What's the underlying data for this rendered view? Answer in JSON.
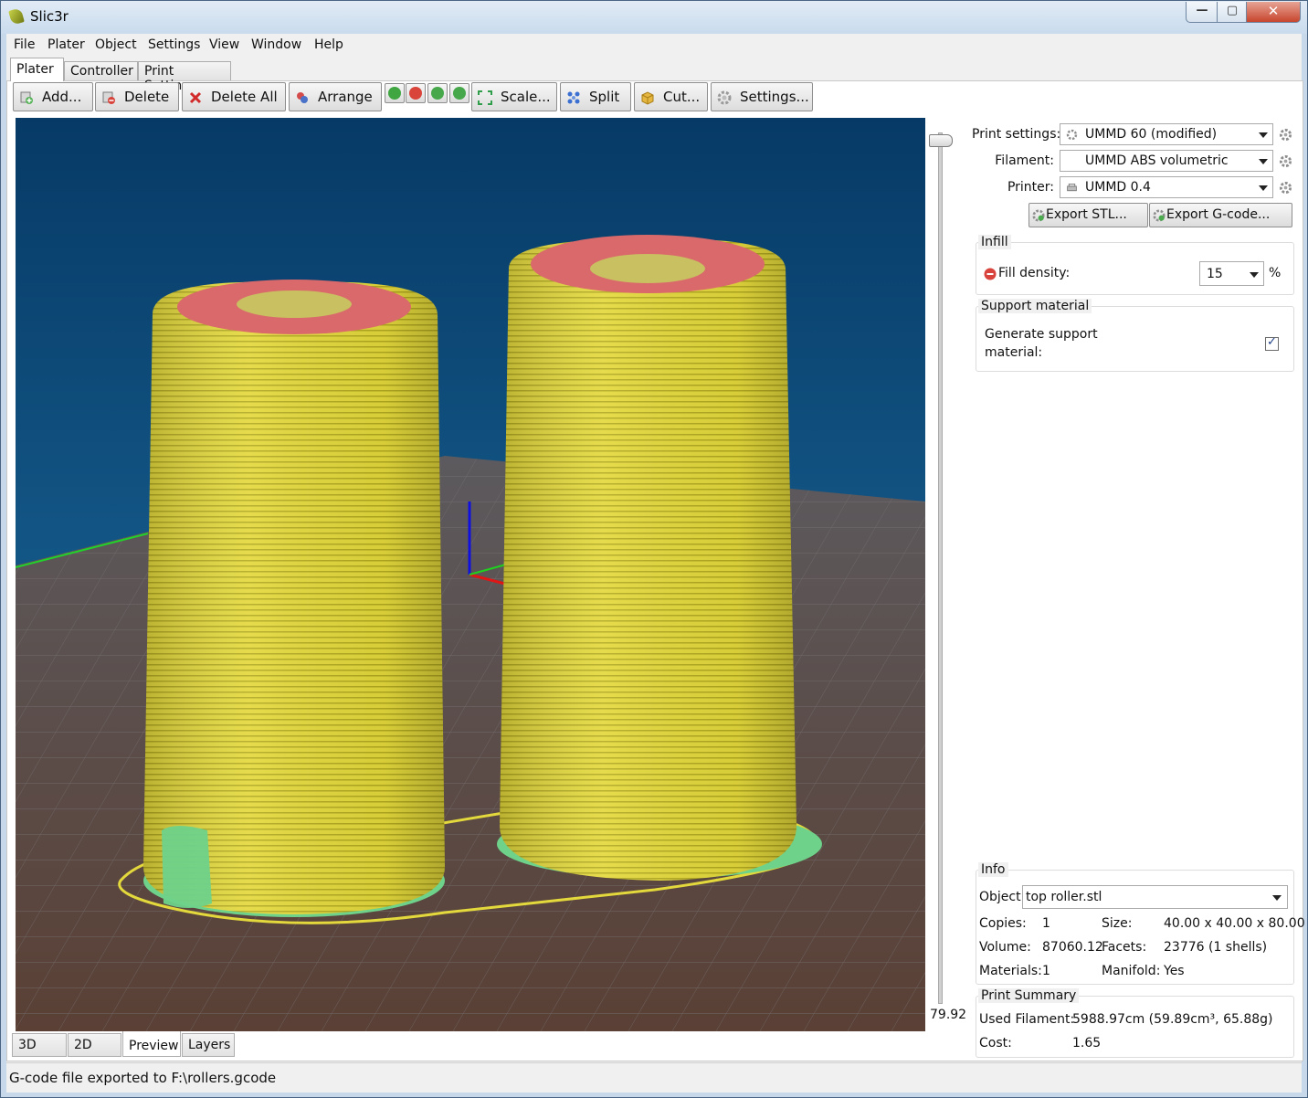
{
  "window": {
    "title": "Slic3r",
    "min_glyph": "—",
    "max_glyph": "▢",
    "close_glyph": "✕"
  },
  "menu": [
    "File",
    "Plater",
    "Object",
    "Settings",
    "View",
    "Window",
    "Help"
  ],
  "main_tabs": [
    "Plater",
    "Controller",
    "Print Settings"
  ],
  "toolbar": {
    "add": "Add...",
    "delete": "Delete",
    "delete_all": "Delete All",
    "arrange": "Arrange",
    "scale": "Scale...",
    "split": "Split",
    "cut": "Cut...",
    "settings": "Settings..."
  },
  "viewport": {
    "layer_height_value": "79.92",
    "view_tabs": [
      "3D",
      "2D",
      "Preview",
      "Layers"
    ],
    "active_view": "Preview",
    "colors": {
      "sky_top": "#073a66",
      "sky_bottom": "#1f74a8",
      "bed": "#5a5556",
      "perimeter": "#e3d83c",
      "top_solid": "#d9696a",
      "skirt": "#e3d83c",
      "first_layer": "#6ed28a"
    }
  },
  "presets": {
    "print_label": "Print settings:",
    "print_value": "UMMD 60 (modified)",
    "filament_label": "Filament:",
    "filament_value": "UMMD ABS volumetric",
    "printer_label": "Printer:",
    "printer_value": "UMMD 0.4"
  },
  "export": {
    "stl": "Export STL...",
    "gcode": "Export G-code..."
  },
  "infill": {
    "title": "Infill",
    "fill_density_label": "Fill density:",
    "fill_density_value": "15",
    "unit": "%"
  },
  "support": {
    "title": "Support material",
    "generate_label_1": "Generate support",
    "generate_label_2": "material:",
    "generate_checked": true
  },
  "info": {
    "title": "Info",
    "object_label": "Object:",
    "object_value": "top roller.stl",
    "copies_label": "Copies:",
    "copies_value": "1",
    "size_label": "Size:",
    "size_value": "40.00 x 40.00 x 80.00",
    "volume_label": "Volume:",
    "volume_value": "87060.12",
    "facets_label": "Facets:",
    "facets_value": "23776 (1 shells)",
    "materials_label": "Materials:",
    "materials_value": "1",
    "manifold_label": "Manifold:",
    "manifold_value": "Yes"
  },
  "print_summary": {
    "title": "Print Summary",
    "used_filament_label": "Used Filament:",
    "used_filament_value": "5988.97cm (59.89cm³, 65.88g)",
    "cost_label": "Cost:",
    "cost_value": "1.65"
  },
  "status": "G-code file exported to F:\\rollers.gcode"
}
